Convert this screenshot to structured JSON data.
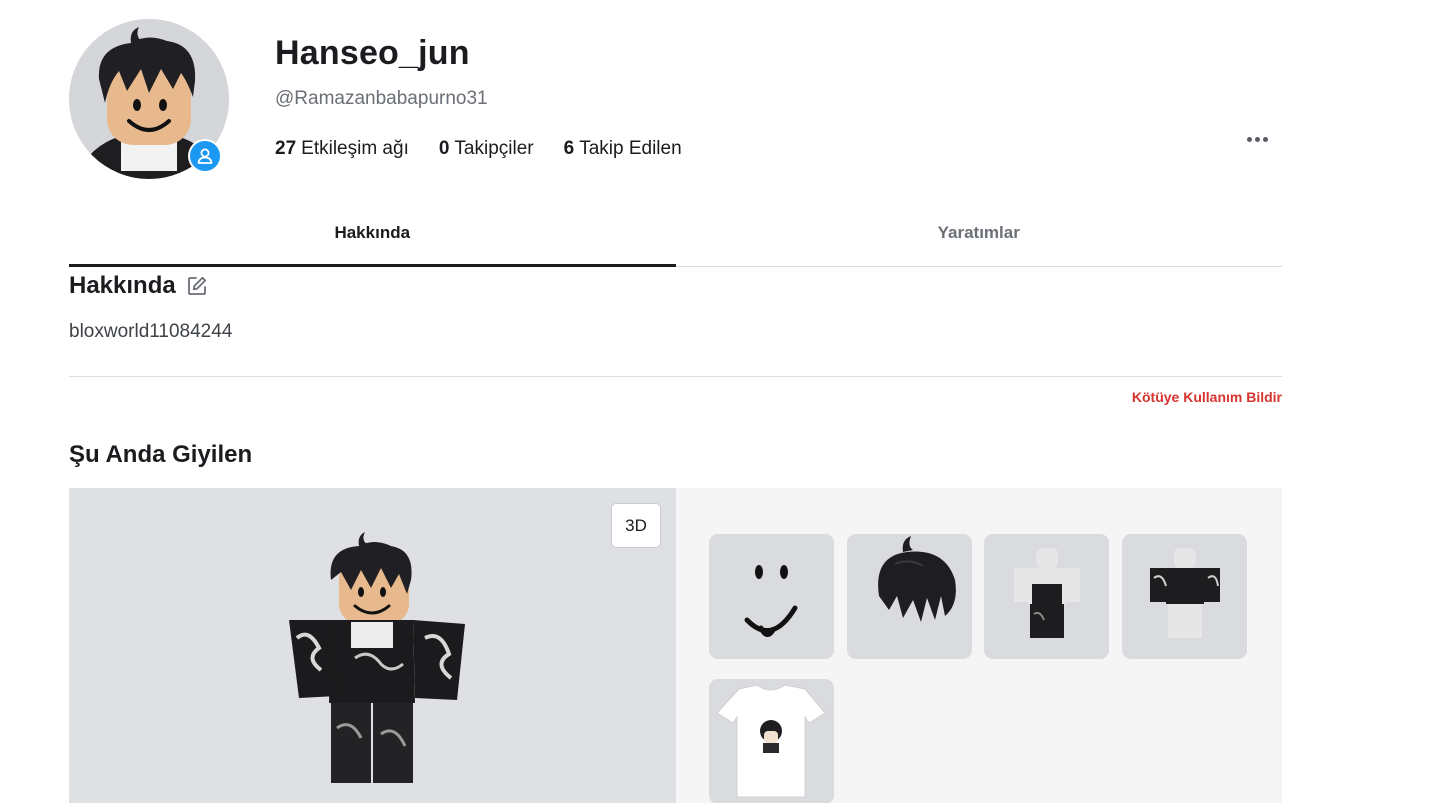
{
  "profile": {
    "display_name": "Hanseo_jun",
    "username": "@Ramazanbabapurno31",
    "stats": [
      {
        "count": "27",
        "label": "Etkileşim ağı"
      },
      {
        "count": "0",
        "label": "Takipçiler"
      },
      {
        "count": "6",
        "label": "Takip Edilen"
      }
    ]
  },
  "tabs": [
    {
      "label": "Hakkında",
      "active": true
    },
    {
      "label": "Yaratımlar",
      "active": false
    }
  ],
  "about": {
    "title": "Hakkında",
    "text": "bloxworld11084244",
    "report_label": "Kötüye Kullanım Bildir"
  },
  "wearing": {
    "title": "Şu Anda Giyilen",
    "view_toggle_label": "3D",
    "items": [
      {
        "icon": "face-smile-icon"
      },
      {
        "icon": "black-hair-icon"
      },
      {
        "icon": "outfit-pants-icon"
      },
      {
        "icon": "outfit-shirt-icon"
      },
      {
        "icon": "tshirt-anime-icon"
      }
    ]
  },
  "colors": {
    "accent_blue": "#1a98f2",
    "report_red": "#d6342f",
    "tab_active": "#1a1c1f"
  }
}
